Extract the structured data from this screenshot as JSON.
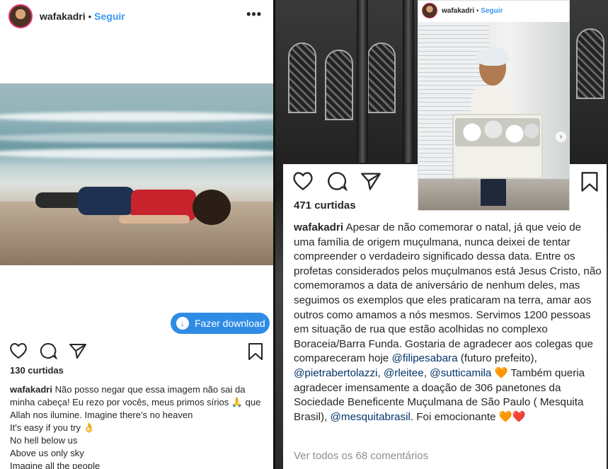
{
  "left_post": {
    "username": "wafakadri",
    "separator": "•",
    "follow_label": "Seguir",
    "more_label": "•••",
    "download_label": "Fazer download",
    "likes": "130 curtidas",
    "caption_user": "wafakadri",
    "caption_lines": [
      "Não posso negar que essa imagem não sai da minha cabeça! Eu rezo por vocês, meus primos sírios 🙏 que Allah nos ilumine. Imagine there's no heaven",
      "It's easy if you try 👌",
      "No hell below us",
      "Above us only sky",
      "Imagine all the people"
    ]
  },
  "right_post": {
    "likes": "471 curtidas",
    "caption_user": "wafakadri",
    "caption_text_1": "Apesar de não comemorar o natal, já que veio de uma família de origem muçulmana, nunca deixei de tentar compreender o verdadeiro significado dessa data. Entre os profetas considerados pelos muçulmanos está Jesus Cristo, não comemoramos a data de aniversário de nenhum deles, mas seguimos os exemplos que eles praticaram na terra, amar aos outros como amamos a nós mesmos. Servimos 1200 pessoas em situação de rua que estão acolhidas no complexo Boraceia/Barra Funda. Gostaria de agradecer aos colegas que compareceram hoje",
    "mention_1": "@filipesabara",
    "caption_text_2": "(futuro prefeito),",
    "mention_2": "@pietrabertolazzi",
    "sep_1": ",",
    "mention_3": "@rleitee",
    "sep_2": ",",
    "mention_4": "@sutticamila",
    "caption_text_3": "🧡 Também queria agradecer imensamente a doação de 306 panetones da Sociedade Beneficente Muçulmana de São Paulo ( Mesquita Brasil),",
    "mention_5": "@mesquitabrasil",
    "caption_text_4": ". Foi emocionante 🧡❤️",
    "view_comments": "Ver todos os 68 comentários"
  },
  "inset_post": {
    "username": "wafakadri",
    "separator": "•",
    "follow_label": "Seguir"
  },
  "colors": {
    "link_blue": "#3897f0",
    "download_blue": "#2f8ce5",
    "mention_blue": "#003569",
    "text": "#262626",
    "muted": "#8e8e8e"
  },
  "icons": [
    "heart-icon",
    "comment-icon",
    "share-icon",
    "bookmark-icon",
    "download-icon",
    "more-icon",
    "next-arrow-icon"
  ]
}
